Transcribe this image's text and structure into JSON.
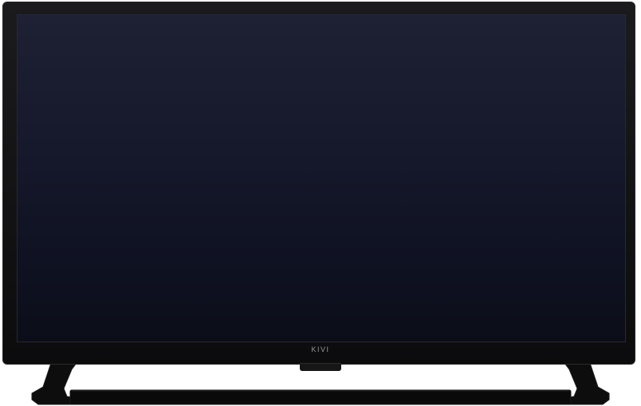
{
  "brand": {
    "logo_text": "KIVI"
  },
  "colors": {
    "bezel": "#121213",
    "screen_top": "#1e2034",
    "screen_bottom": "#0b0d18",
    "stand": "#0d0d0e",
    "logo": "#9a9a9c"
  }
}
